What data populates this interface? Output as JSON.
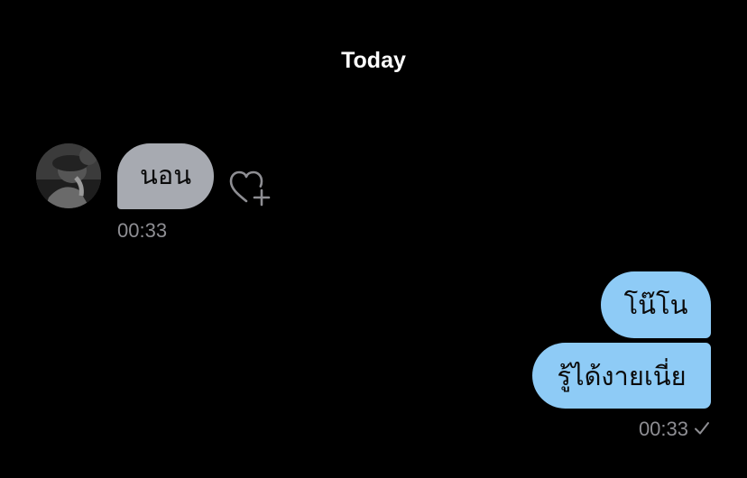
{
  "conversation": {
    "date_header": "Today",
    "messages": [
      {
        "direction": "received",
        "text": "นอน",
        "time": "00:33",
        "reaction_icon": "heart-add-icon"
      },
      {
        "direction": "sent",
        "text": "โน๊โน"
      },
      {
        "direction": "sent",
        "text": "รู้ได้งายเนี่ย",
        "time": "00:33",
        "status_icon": "checkmark-icon"
      }
    ]
  },
  "colors": {
    "background": "#000000",
    "received_bubble": "#a7aab1",
    "sent_bubble": "#8ecbf6",
    "timestamp": "#8e8e93"
  }
}
